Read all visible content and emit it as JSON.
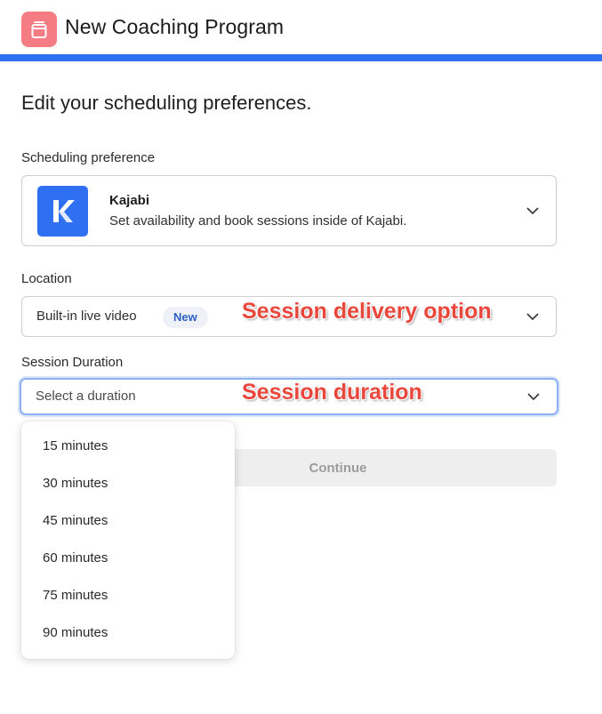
{
  "header": {
    "title": "New Coaching Program",
    "icon": "program-icon",
    "icon_color": "#f47c82",
    "accent_color": "#2f6ff2"
  },
  "page": {
    "heading": "Edit your scheduling preferences."
  },
  "scheduling": {
    "label": "Scheduling preference",
    "selected_title": "Kajabi",
    "selected_description": "Set availability and book sessions inside of Kajabi.",
    "logo": "kajabi-logo"
  },
  "location": {
    "label": "Location",
    "value": "Built-in live video",
    "badge": "New"
  },
  "duration": {
    "label": "Session Duration",
    "placeholder": "Select a duration",
    "options": [
      "15 minutes",
      "30 minutes",
      "45 minutes",
      "60 minutes",
      "75 minutes",
      "90 minutes"
    ]
  },
  "actions": {
    "continue_label": "Continue"
  },
  "annotations": {
    "location_note": "Session delivery option",
    "duration_note": "Session duration"
  }
}
